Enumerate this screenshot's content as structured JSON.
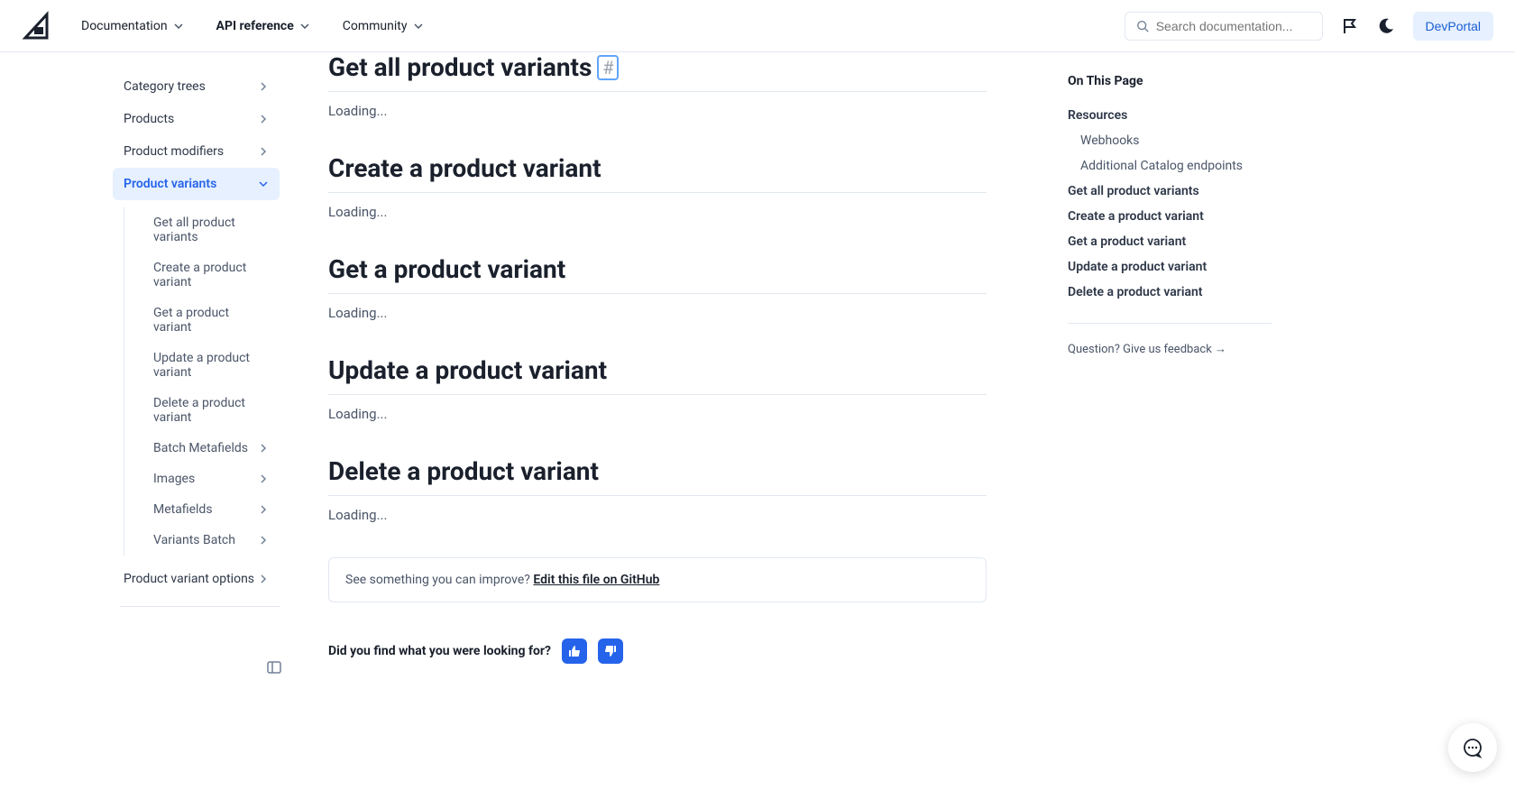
{
  "header": {
    "nav": {
      "documentation": "Documentation",
      "api_reference": "API reference",
      "community": "Community"
    },
    "search_placeholder": "Search documentation...",
    "devportal": "DevPortal"
  },
  "sidebar": {
    "items": [
      {
        "label": "Category trees"
      },
      {
        "label": "Products"
      },
      {
        "label": "Product modifiers"
      },
      {
        "label": "Product variants"
      }
    ],
    "subitems": [
      {
        "label": "Get all product variants"
      },
      {
        "label": "Create a product variant"
      },
      {
        "label": "Get a product variant"
      },
      {
        "label": "Update a product variant"
      },
      {
        "label": "Delete a product variant"
      },
      {
        "label": "Batch Metafields"
      },
      {
        "label": "Images"
      },
      {
        "label": "Metafields"
      },
      {
        "label": "Variants Batch"
      }
    ],
    "last": "Product variant options"
  },
  "main": {
    "sections": [
      {
        "title": "Get all product variants",
        "status": "Loading..."
      },
      {
        "title": "Create a product variant",
        "status": "Loading..."
      },
      {
        "title": "Get a product variant",
        "status": "Loading..."
      },
      {
        "title": "Update a product variant",
        "status": "Loading..."
      },
      {
        "title": "Delete a product variant",
        "status": "Loading..."
      }
    ],
    "edit_prompt": "See something you can improve? ",
    "edit_link": "Edit this file on GitHub",
    "feedback_question": "Did you find what you were looking for?"
  },
  "toc": {
    "title": "On This Page",
    "items": [
      {
        "label": "Resources",
        "bold": true
      },
      {
        "label": "Webhooks",
        "sub": true
      },
      {
        "label": "Additional Catalog endpoints",
        "sub": true
      },
      {
        "label": "Get all product variants",
        "bold": true
      },
      {
        "label": "Create a product variant",
        "bold": true
      },
      {
        "label": "Get a product variant",
        "bold": true
      },
      {
        "label": "Update a product variant",
        "bold": true
      },
      {
        "label": "Delete a product variant",
        "bold": true
      }
    ],
    "feedback": "Question? Give us feedback →"
  }
}
